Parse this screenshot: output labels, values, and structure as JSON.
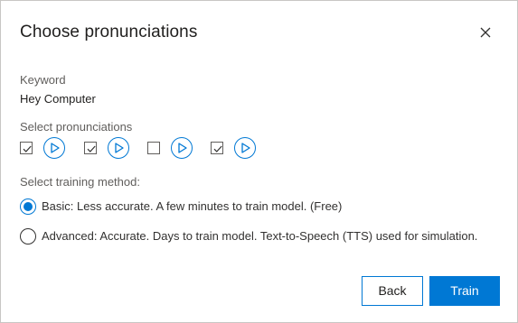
{
  "dialog": {
    "title": "Choose pronunciations",
    "close_icon": "close-icon"
  },
  "keyword": {
    "label": "Keyword",
    "value": "Hey Computer"
  },
  "pronunciations": {
    "label": "Select pronunciations",
    "items": [
      {
        "checked": true
      },
      {
        "checked": true
      },
      {
        "checked": false
      },
      {
        "checked": true
      }
    ]
  },
  "training": {
    "label": "Select training method:",
    "options": [
      {
        "label": "Basic: Less accurate. A few minutes to train model. (Free)",
        "selected": true
      },
      {
        "label": "Advanced: Accurate. Days to train model. Text-to-Speech (TTS) used for simulation.",
        "selected": false
      }
    ]
  },
  "footer": {
    "back_label": "Back",
    "train_label": "Train"
  },
  "colors": {
    "accent": "#0078d4",
    "text": "#201f1e",
    "label": "#605e5c"
  }
}
